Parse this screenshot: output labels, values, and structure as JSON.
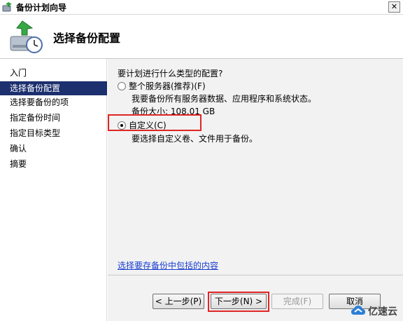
{
  "window": {
    "title": "备份计划向导",
    "close_glyph": "✕"
  },
  "header": {
    "page_title": "选择备份配置"
  },
  "sidebar": {
    "items": [
      {
        "label": "入门",
        "active": false
      },
      {
        "label": "选择备份配置",
        "active": true
      },
      {
        "label": "选择要备份的项",
        "active": false
      },
      {
        "label": "指定备份时间",
        "active": false
      },
      {
        "label": "指定目标类型",
        "active": false
      },
      {
        "label": "确认",
        "active": false
      },
      {
        "label": "摘要",
        "active": false
      }
    ]
  },
  "main": {
    "question": "要计划进行什么类型的配置?",
    "options": [
      {
        "label": "整个服务器(推荐)(F)",
        "selected": false,
        "description": "我要备份所有服务器数据、应用程序和系统状态。",
        "size_text": "备份大小: 108.01 GB"
      },
      {
        "label": "自定义(C)",
        "selected": true,
        "description": "要选择自定义卷、文件用于备份。"
      }
    ],
    "help_link": "选择要存备份中包括的内容"
  },
  "footer": {
    "back_label": "< 上一步(P)",
    "next_label": "下一步(N) >",
    "finish_label": "完成(F)",
    "cancel_label": "取消"
  },
  "watermark": {
    "text": "亿速云"
  },
  "colors": {
    "active_nav_bg": "#1c2f6e",
    "highlight_border": "#e02424",
    "link_color": "#1a3ecf"
  }
}
